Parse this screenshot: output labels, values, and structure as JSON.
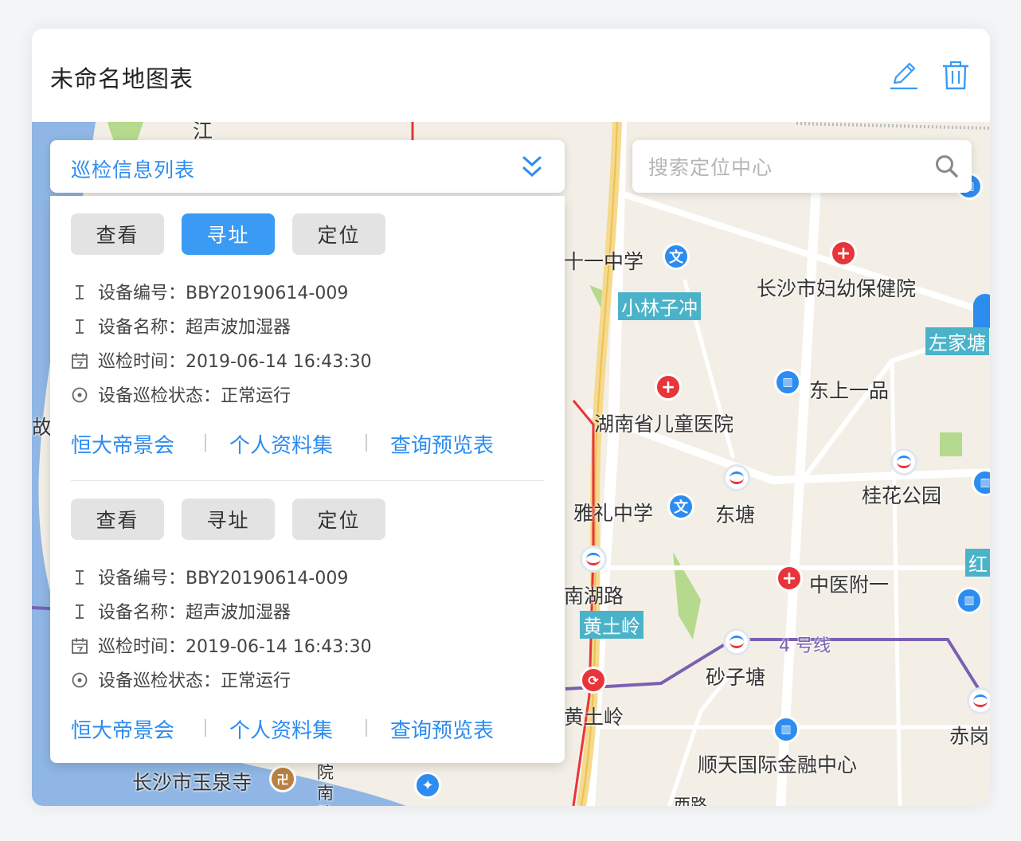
{
  "header": {
    "title": "未命名地图表",
    "edit_icon": "pencil-icon",
    "delete_icon": "trash-icon"
  },
  "colors": {
    "accent": "#2d8cf0",
    "active_button": "#3a9bf4",
    "button_bg": "#e3e3e3",
    "metro_line": "#7b5fb3"
  },
  "panel": {
    "title": "巡检信息列表",
    "expand_icon": "double-chevron-down-icon"
  },
  "search": {
    "placeholder": "搜索定位中心",
    "icon": "search-icon"
  },
  "records": [
    {
      "buttons": [
        {
          "label": "查看",
          "active": false
        },
        {
          "label": "寻址",
          "active": true
        },
        {
          "label": "定位",
          "active": false
        }
      ],
      "fields": [
        {
          "icon": "text-cursor-icon",
          "key": "设备编号：",
          "value": "BBY20190614-009"
        },
        {
          "icon": "text-cursor-icon",
          "key": "设备名称：",
          "value": "超声波加湿器"
        },
        {
          "icon": "calendar-icon",
          "key": "巡检时间：",
          "value": "2019-06-14    16:43:30"
        },
        {
          "icon": "target-icon",
          "key": "设备巡检状态：",
          "value": "正常运行"
        }
      ],
      "links": [
        "恒大帝景会",
        "个人资料集",
        "查询预览表"
      ]
    },
    {
      "buttons": [
        {
          "label": "查看",
          "active": false
        },
        {
          "label": "寻址",
          "active": false
        },
        {
          "label": "定位",
          "active": false
        }
      ],
      "fields": [
        {
          "icon": "text-cursor-icon",
          "key": "设备编号：",
          "value": "BBY20190614-009"
        },
        {
          "icon": "text-cursor-icon",
          "key": "设备名称：",
          "value": "超声波加湿器"
        },
        {
          "icon": "calendar-icon",
          "key": "巡检时间：",
          "value": "2019-06-14    16:43:30"
        },
        {
          "icon": "target-icon",
          "key": "设备巡检状态：",
          "value": "正常运行"
        }
      ],
      "links": [
        "恒大帝景会",
        "个人资料集",
        "查询预览表"
      ]
    }
  ],
  "map": {
    "labels": {
      "school11": "十一中学",
      "xiaolinzichong": "小林子冲",
      "maternity": "长沙市妇幼保健院",
      "zuojiatang": "左家塘",
      "dongshang": "东上一品",
      "childrens_hospital": "湖南省儿童医院",
      "guihua": "桂花公园",
      "yali": "雅礼中学",
      "dongtang": "东塘",
      "nanhu": "南湖路",
      "huangtuling_tag": "黄土岭",
      "zhongyi": "中医附一",
      "line4": "4 号线",
      "shazitang": "砂子塘",
      "huangtuling": "黄土岭",
      "chigang": "赤岗",
      "shuntian": "顺天国际金融中心",
      "yuquansi": "长沙市玉泉寺",
      "yuannan": "院南路",
      "xilu": "西路",
      "gu": "故",
      "jiang": "江",
      "hong": "红"
    }
  }
}
